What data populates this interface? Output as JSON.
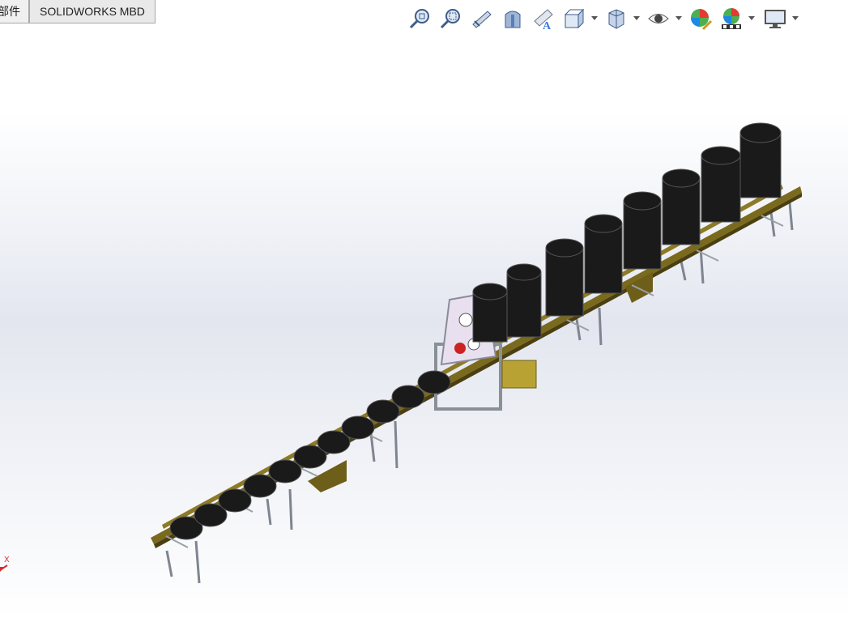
{
  "tabs": [
    {
      "label": "部件",
      "active": false
    },
    {
      "label": "SOLIDWORKS MBD",
      "active": true
    }
  ],
  "heads_up_toolbar": [
    {
      "name": "zoom-to-fit-icon"
    },
    {
      "name": "zoom-to-area-icon"
    },
    {
      "name": "previous-view-icon"
    },
    {
      "name": "section-view-icon"
    },
    {
      "name": "dynamic-annotation-views-icon"
    },
    {
      "name": "view-orientation-icon"
    },
    {
      "name": "display-style-icon"
    },
    {
      "name": "hide-show-items-icon"
    },
    {
      "name": "edit-appearance-icon"
    },
    {
      "name": "apply-scene-icon"
    },
    {
      "name": "view-settings-icon"
    }
  ],
  "triad": {
    "axis_label": "X"
  },
  "colors": {
    "frame": "#7a6a1e",
    "frame_dark": "#4b3f10",
    "roll": "#1a1a1a",
    "leg": "#7f8590",
    "accent": "#3a7bd5"
  }
}
